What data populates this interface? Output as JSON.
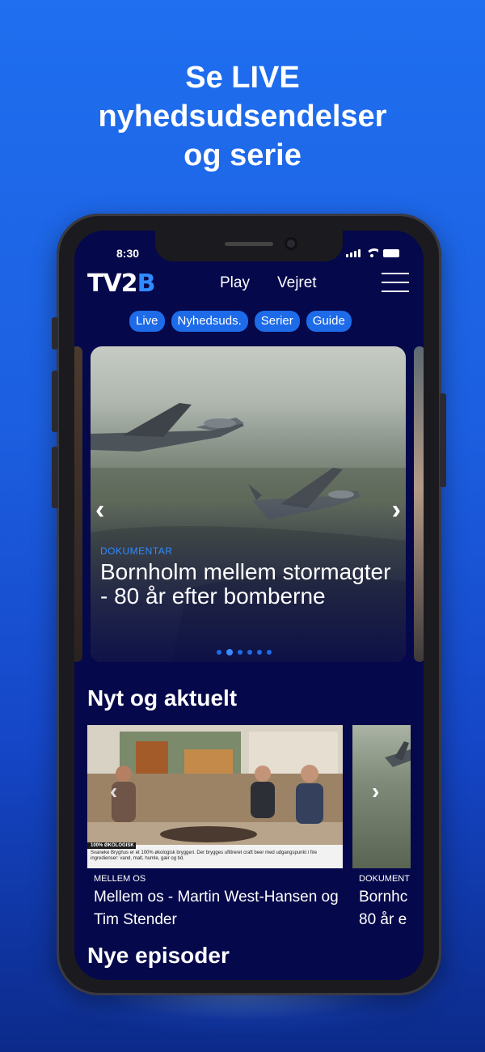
{
  "promo": {
    "headline_lines": [
      "Se LIVE",
      "nyhedsudsendelser",
      "og serie"
    ]
  },
  "status_bar": {
    "time": "8:30"
  },
  "app": {
    "logo": {
      "text": "TV2",
      "accent": "B"
    },
    "nav": [
      "Play",
      "Vejret"
    ],
    "chips": [
      "Live",
      "Nyhedsuds.",
      "Serier",
      "Guide"
    ]
  },
  "hero": {
    "category": "DOKUMENTAR",
    "title": "Bornholm mellem stormagter - 80 år efter bomberne",
    "slide_count": 6,
    "active_slide": 1
  },
  "sections": {
    "news": {
      "title": "Nyt og aktuelt",
      "cards": [
        {
          "category": "MELLEM OS",
          "title": "Mellem os - Martin West-Hansen og Tim Stender",
          "lower_third_tag": "100% ØKOLOGISK",
          "lower_third_text": "Svaneke Bryghus er et 100% økologisk bryggeri. Der brygges ufiltreret craft beer med udgangspunkt i fire ingredienser: vand, malt, humle, gær og tid."
        },
        {
          "category": "DOKUMENT",
          "title": "Bornhc 80 år e"
        }
      ]
    },
    "episodes": {
      "title": "Nye episoder"
    }
  },
  "colors": {
    "background_top": "#1f6ff0",
    "screen_bg": "#05084a",
    "accent": "#1d6be8",
    "logo_accent": "#2f8bff"
  }
}
